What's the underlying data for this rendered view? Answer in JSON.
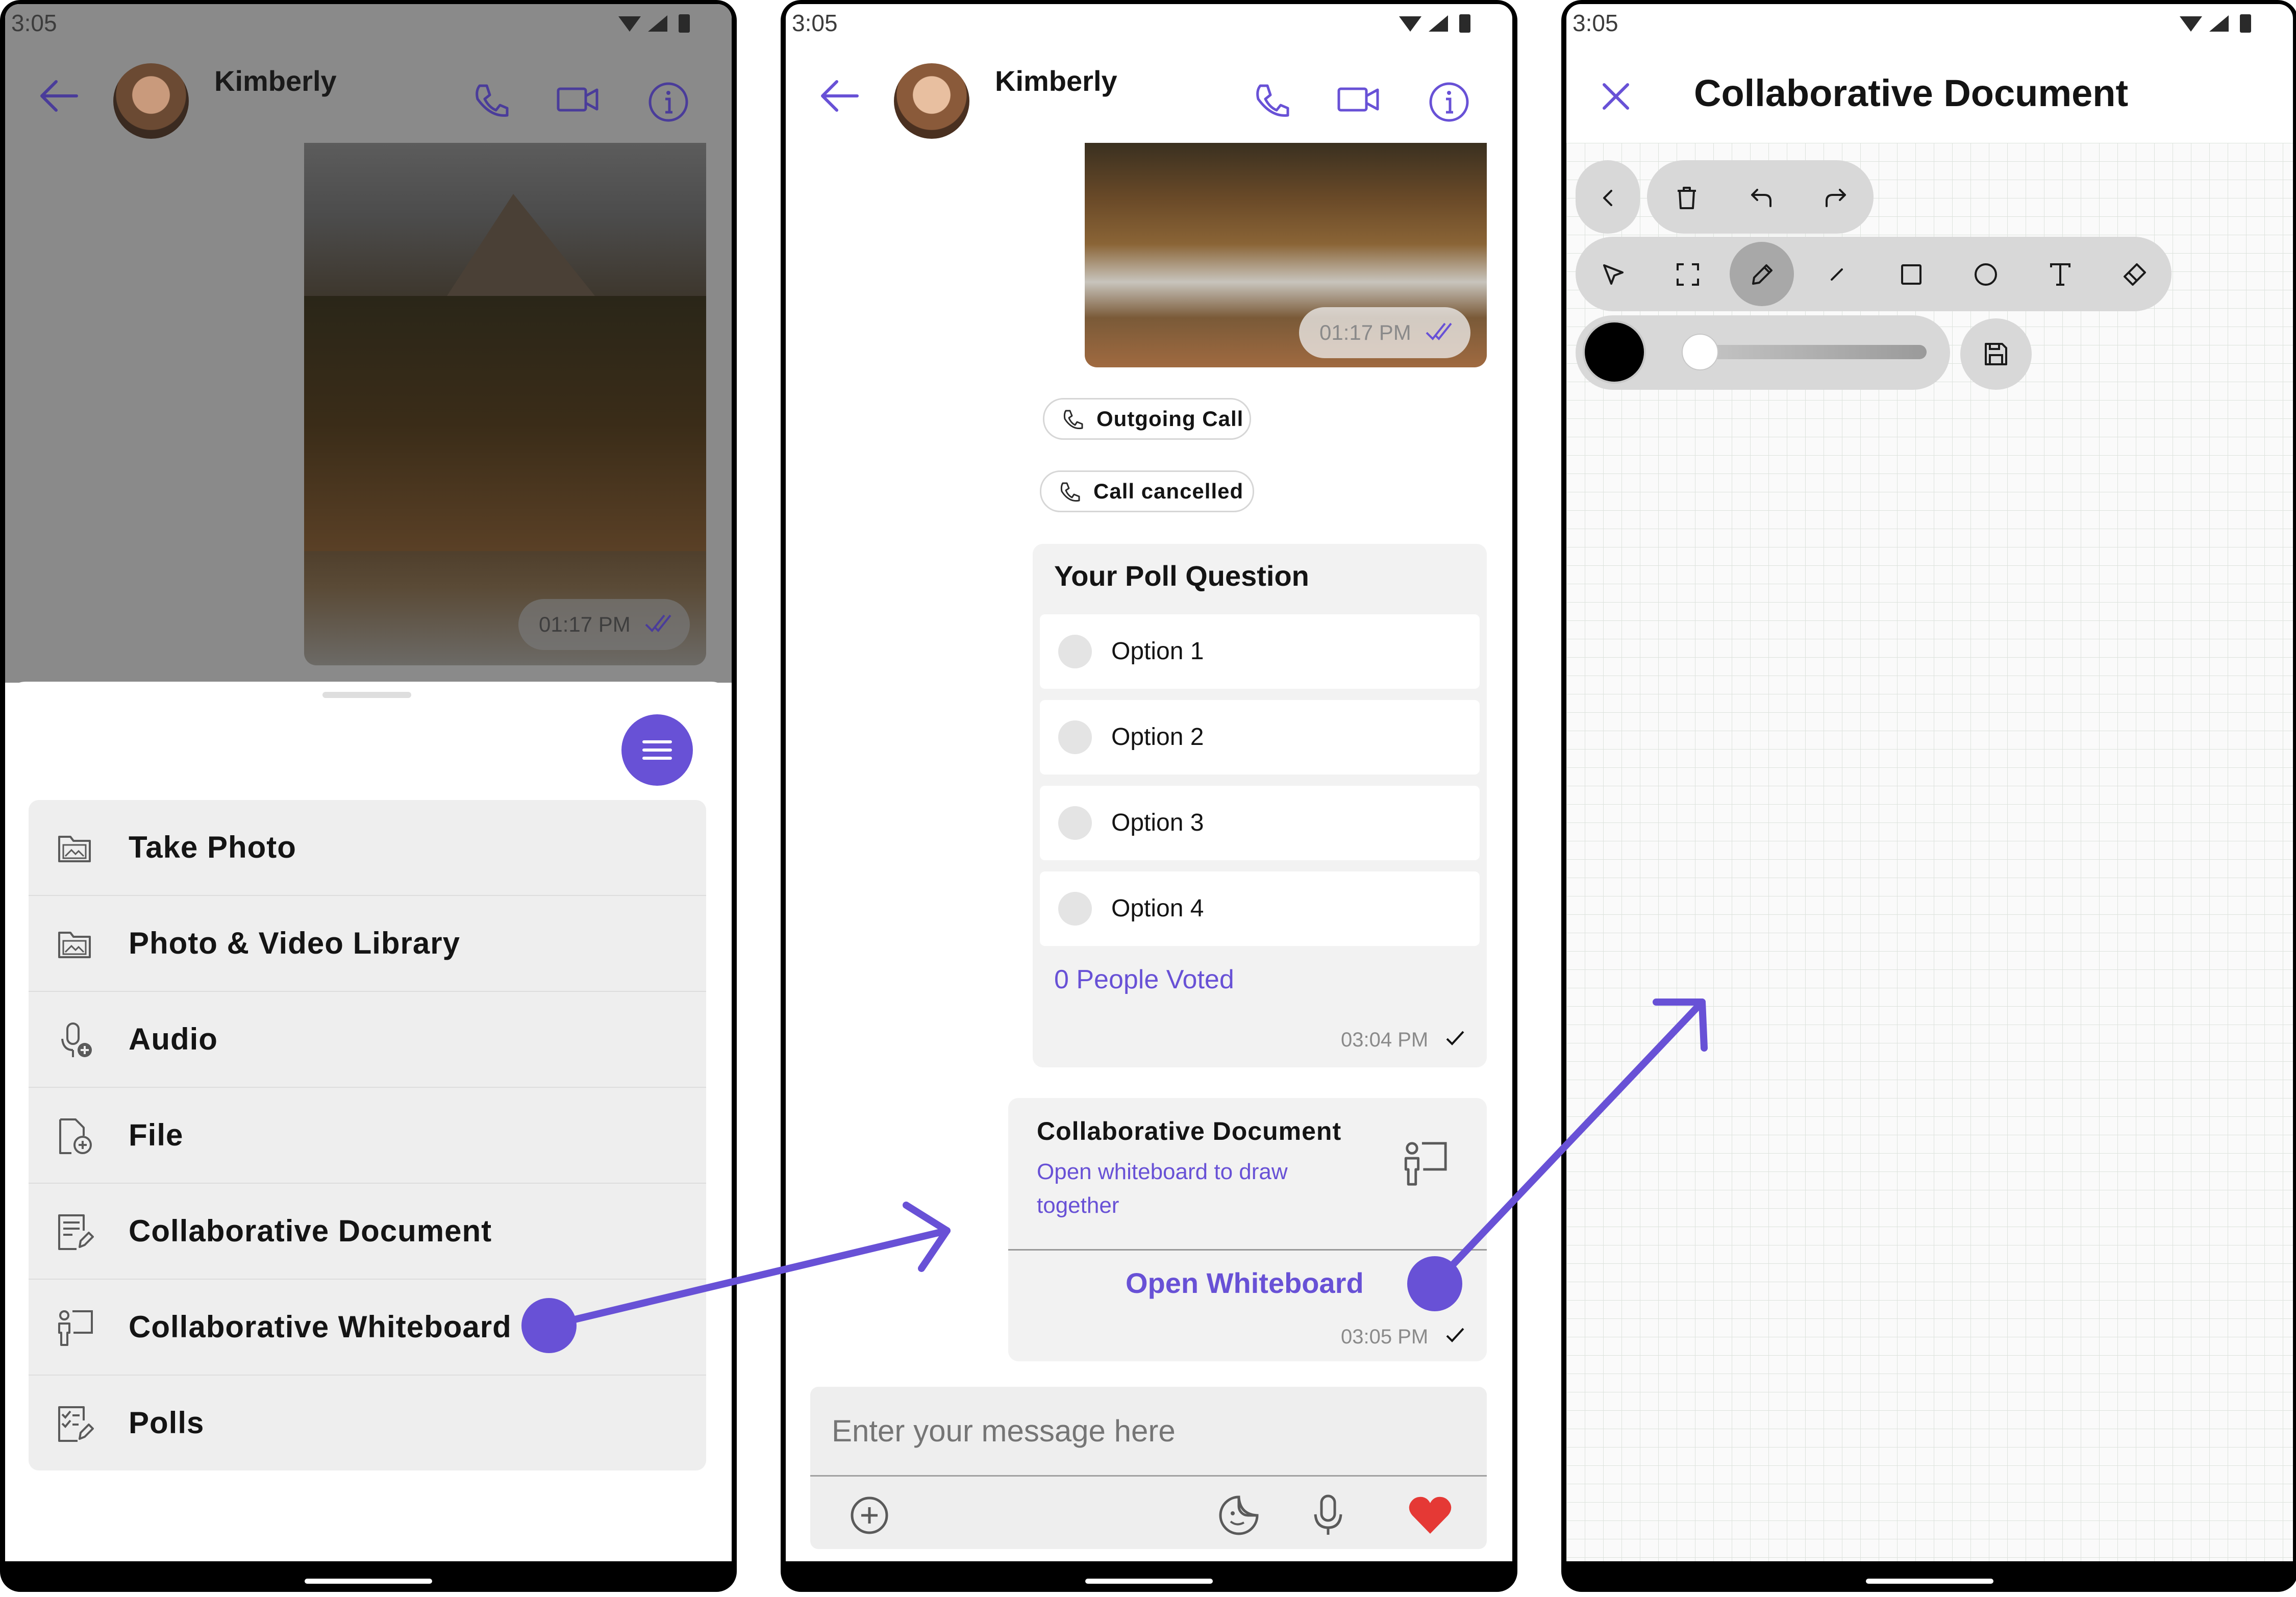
{
  "status": {
    "time": "3:05"
  },
  "phone1": {
    "header": {
      "contact_name": "Kimberly"
    },
    "image_timestamp": "01:17 PM",
    "menu": [
      {
        "label": "Take Photo",
        "icon": "image-folder-icon"
      },
      {
        "label": "Photo & Video Library",
        "icon": "image-folder-icon"
      },
      {
        "label": "Audio",
        "icon": "microphone-add-icon"
      },
      {
        "label": "File",
        "icon": "file-add-icon"
      },
      {
        "label": "Collaborative Document",
        "icon": "document-edit-icon"
      },
      {
        "label": "Collaborative Whiteboard",
        "icon": "whiteboard-presenter-icon"
      },
      {
        "label": "Polls",
        "icon": "poll-icon"
      }
    ]
  },
  "phone2": {
    "header": {
      "contact_name": "Kimberly"
    },
    "image_timestamp": "01:17 PM",
    "chips": [
      {
        "label": "Outgoing Call",
        "icon": "phone-icon"
      },
      {
        "label": "Call cancelled",
        "icon": "phone-icon"
      }
    ],
    "poll": {
      "question": "Your Poll Question",
      "options": [
        "Option 1",
        "Option 2",
        "Option 3",
        "Option 4"
      ],
      "votes": "0 People Voted",
      "timestamp": "03:04 PM"
    },
    "collab_card": {
      "title": "Collaborative Document",
      "subtitle_line1": "Open whiteboard to draw",
      "subtitle_line2": "together",
      "action": "Open Whiteboard",
      "timestamp": "03:05 PM"
    },
    "composer": {
      "placeholder": "Enter your message here"
    }
  },
  "phone3": {
    "title": "Collaborative Document",
    "toolbar_row1": [
      "chevron-left-icon",
      "trash-icon",
      "undo-icon",
      "redo-icon"
    ],
    "toolbar_row2": [
      "select-arrow-icon",
      "marquee-select-icon",
      "pencil-icon",
      "line-icon",
      "rectangle-icon",
      "circle-icon",
      "text-icon",
      "eraser-icon"
    ],
    "selected_tool": "pencil-icon",
    "stroke_color": "#000000",
    "stroke_width_level": 0.05
  },
  "colors": {
    "accent": "#6851d6",
    "heart": "#e53935",
    "menu_bg": "#eeeeee"
  }
}
